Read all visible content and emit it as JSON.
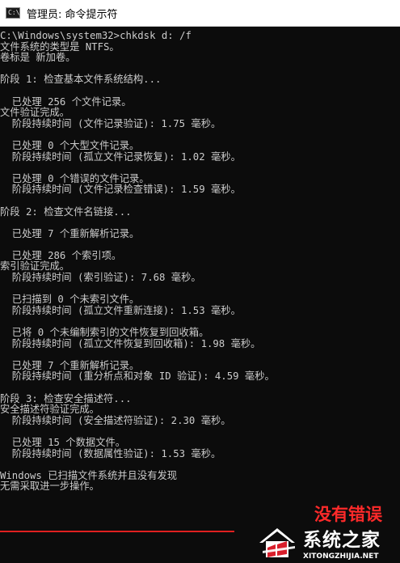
{
  "window": {
    "title": "管理员: 命令提示符",
    "icon": "cmd-icon"
  },
  "console": {
    "lines": [
      "C:\\Windows\\system32>chkdsk d: /f",
      "文件系统的类型是 NTFS。",
      "卷标是 新加卷。",
      "",
      "阶段 1: 检查基本文件系统结构...",
      "",
      "  已处理 256 个文件记录。",
      "文件验证完成。",
      "  阶段持续时间 (文件记录验证): 1.75 毫秒。",
      "",
      "  已处理 0 个大型文件记录。",
      "  阶段持续时间 (孤立文件记录恢复): 1.02 毫秒。",
      "",
      "  已处理 0 个错误的文件记录。",
      "  阶段持续时间 (文件记录检查错误): 1.59 毫秒。",
      "",
      "阶段 2: 检查文件名链接...",
      "",
      "  已处理 7 个重新解析记录。",
      "",
      "  已处理 286 个索引项。",
      "索引验证完成。",
      "  阶段持续时间 (索引验证): 7.68 毫秒。",
      "",
      "  已扫描到 0 个未索引文件。",
      "  阶段持续时间 (孤立文件重新连接): 1.53 毫秒。",
      "",
      "  已将 0 个未编制索引的文件恢复到回收箱。",
      "  阶段持续时间 (孤立文件恢复到回收箱): 1.98 毫秒。",
      "",
      "  已处理 7 个重新解析记录。",
      "  阶段持续时间 (重分析点和对象 ID 验证): 4.59 毫秒。",
      "",
      "阶段 3: 检查安全描述符...",
      "安全描述符验证完成。",
      "  阶段持续时间 (安全描述符验证): 2.30 毫秒。",
      "",
      "  已处理 15 个数据文件。",
      "  阶段持续时间 (数据属性验证): 1.53 毫秒。",
      "",
      "Windows 已扫描文件系统并且没有发现",
      "无需采取进一步操作。"
    ]
  },
  "annotation": {
    "text": "没有错误",
    "color": "#ff2a2a"
  },
  "watermark": {
    "cn": "系统之家",
    "en": "XITONGZHIJIA.NET"
  },
  "colors": {
    "console_bg": "#0c0c0c",
    "console_fg": "#cccccc",
    "highlight": "#e02020"
  }
}
